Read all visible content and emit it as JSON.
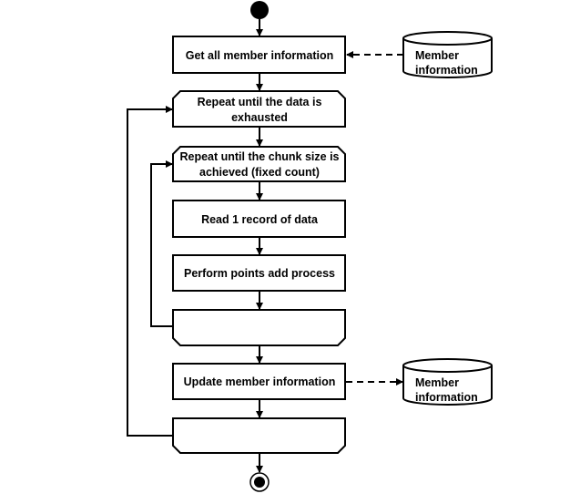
{
  "diagram": {
    "nodes": {
      "get_all": {
        "label": "Get all member information"
      },
      "loop_data_start": {
        "lines": [
          "Repeat until the data is",
          "exhausted"
        ]
      },
      "loop_chunk_start": {
        "lines": [
          "Repeat until the chunk size is",
          "achieved (fixed count)"
        ]
      },
      "read_record": {
        "label": "Read 1 record of data"
      },
      "points_add": {
        "label": "Perform points add process"
      },
      "loop_chunk_end": {
        "label": ""
      },
      "update_member": {
        "label": "Update member information"
      },
      "loop_data_end": {
        "label": ""
      },
      "db_source": {
        "lines": [
          "Member",
          "information"
        ]
      },
      "db_target": {
        "lines": [
          "Member",
          "information"
        ]
      }
    }
  }
}
